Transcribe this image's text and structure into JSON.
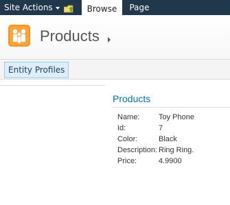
{
  "ribbon": {
    "site_actions_label": "Site Actions",
    "tabs": [
      {
        "label": "Browse",
        "selected": true
      },
      {
        "label": "Page",
        "selected": false
      }
    ],
    "background_color": "#21374c"
  },
  "header": {
    "title": "Products",
    "icon": "people-icon",
    "icon_color": "#f7941d"
  },
  "toolbar": {
    "entity_profiles_label": "Entity Profiles"
  },
  "content": {
    "section_title": "Products",
    "title_color": "#0072bc",
    "fields": [
      {
        "label": "Name:",
        "value": "Toy Phone"
      },
      {
        "label": "Id:",
        "value": "7"
      },
      {
        "label": "Color:",
        "value": "Black"
      },
      {
        "label": "Description:",
        "value": "Ring Ring."
      },
      {
        "label": "Price:",
        "value": "4.9900"
      }
    ]
  }
}
